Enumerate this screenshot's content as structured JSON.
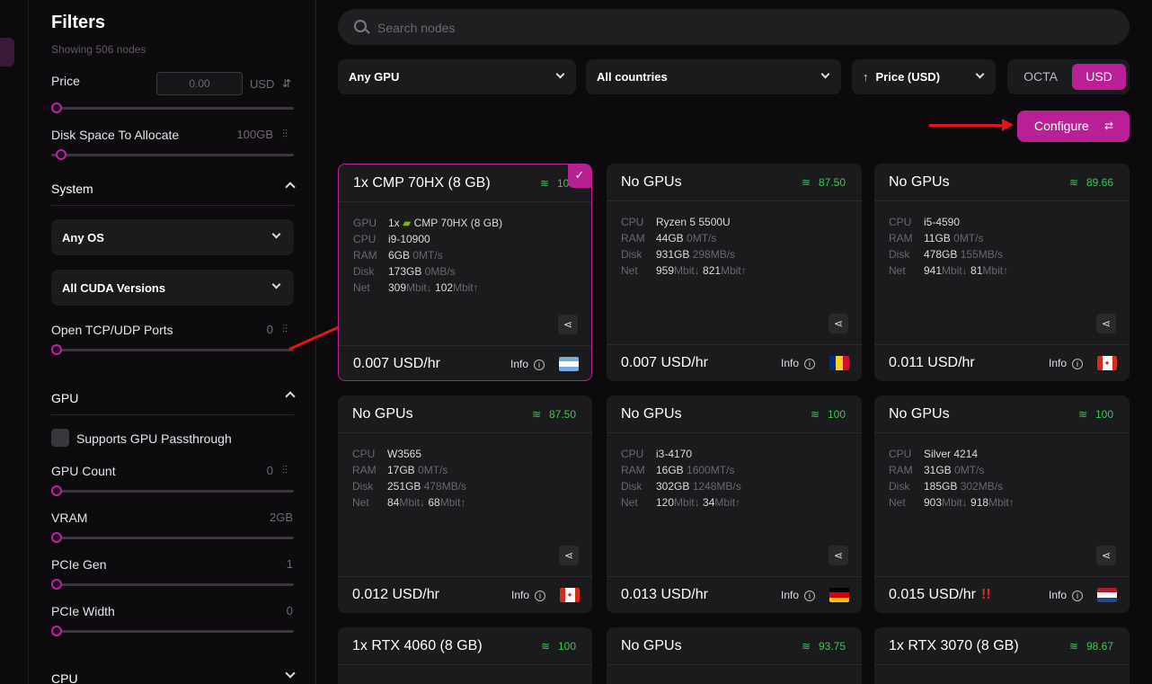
{
  "sidebar": {
    "title": "Filters",
    "subtitle": "Showing 506 nodes",
    "price": {
      "label": "Price",
      "input_value": "0.00",
      "unit": "USD",
      "level": 0
    },
    "disk": {
      "label": "Disk Space To Allocate",
      "value": "100GB",
      "level": 0.02
    },
    "system": {
      "label": "System",
      "os_select": "Any OS",
      "cuda_select": "All CUDA Versions"
    },
    "ports": {
      "label": "Open TCP/UDP Ports",
      "value": "0",
      "level": 0
    },
    "gpu": {
      "label": "GPU",
      "passthrough": "Supports GPU Passthrough",
      "count": {
        "label": "GPU Count",
        "value": "0",
        "level": 0
      },
      "vram": {
        "label": "VRAM",
        "value": "2GB",
        "level": 0
      },
      "pcie_gen": {
        "label": "PCIe Gen",
        "value": "1",
        "level": 0
      },
      "pcie_width": {
        "label": "PCIe Width",
        "value": "0",
        "level": 0
      }
    },
    "cpu": {
      "label": "CPU"
    }
  },
  "search": {
    "placeholder": "Search nodes"
  },
  "filters": {
    "gpu": "Any GPU",
    "country": "All countries",
    "sort": "Price (USD)",
    "currency_options": [
      "OCTA",
      "USD"
    ],
    "currency_selected": "USD"
  },
  "configure_label": "Configure",
  "icons": {
    "search": "search-icon",
    "sliders": "sliders-icon",
    "share": "share-icon",
    "wifi": "wifi-icon",
    "info": "info-icon",
    "check": "check-icon"
  },
  "colors": {
    "accent": "#b91f97",
    "score": "#3fc55a",
    "annotation_arrow": "#e0151c"
  },
  "cards": [
    {
      "title": "1x CMP 70HX (8 GB)",
      "score": "100",
      "selected": true,
      "gpu": {
        "count": "1x",
        "name": "CMP 70HX (8 GB)"
      },
      "cpu": "i9-10900",
      "ram": "6GB",
      "ram_speed": "0MT/s",
      "disk": "173GB",
      "disk_speed": "0MB/s",
      "net_down": "309",
      "net_up": "102",
      "price": "0.007 USD/hr",
      "info": "Info",
      "flag": "ar"
    },
    {
      "title": "No GPUs",
      "score": "87.50",
      "cpu": "Ryzen 5 5500U",
      "ram": "44GB",
      "ram_speed": "0MT/s",
      "disk": "931GB",
      "disk_speed": "298MB/s",
      "net_down": "959",
      "net_up": "821",
      "price": "0.007 USD/hr",
      "info": "Info",
      "flag": "ro"
    },
    {
      "title": "No GPUs",
      "score": "89.66",
      "cpu": "i5-4590",
      "ram": "11GB",
      "ram_speed": "0MT/s",
      "disk": "478GB",
      "disk_speed": "155MB/s",
      "net_down": "941",
      "net_up": "81",
      "price": "0.011 USD/hr",
      "info": "Info",
      "flag": "ca"
    },
    {
      "title": "No GPUs",
      "score": "87.50",
      "cpu": "W3565",
      "ram": "17GB",
      "ram_speed": "0MT/s",
      "disk": "251GB",
      "disk_speed": "478MB/s",
      "net_down": "84",
      "net_up": "68",
      "price": "0.012 USD/hr",
      "info": "Info",
      "flag": "ca"
    },
    {
      "title": "No GPUs",
      "score": "100",
      "cpu": "i3-4170",
      "ram": "16GB",
      "ram_speed": "1600MT/s",
      "disk": "302GB",
      "disk_speed": "1248MB/s",
      "net_down": "120",
      "net_up": "34",
      "price": "0.013 USD/hr",
      "info": "Info",
      "flag": "de"
    },
    {
      "title": "No GPUs",
      "score": "100",
      "cpu": "Silver 4214",
      "ram": "31GB",
      "ram_speed": "0MT/s",
      "disk": "185GB",
      "disk_speed": "302MB/s",
      "net_down": "903",
      "net_up": "918",
      "price": "0.015 USD/hr",
      "warn": "!!",
      "info": "Info",
      "flag": "nl"
    },
    {
      "title": "1x RTX 4060 (8 GB)",
      "score": "100"
    },
    {
      "title": "No GPUs",
      "score": "93.75"
    },
    {
      "title": "1x RTX 3070 (8 GB)",
      "score": "98.67"
    }
  ],
  "labels": {
    "gpu": "GPU",
    "cpu": "CPU",
    "ram": "RAM",
    "disk": "Disk",
    "net": "Net",
    "mbit": "Mbit",
    "down": "↓",
    "up": "↑"
  }
}
